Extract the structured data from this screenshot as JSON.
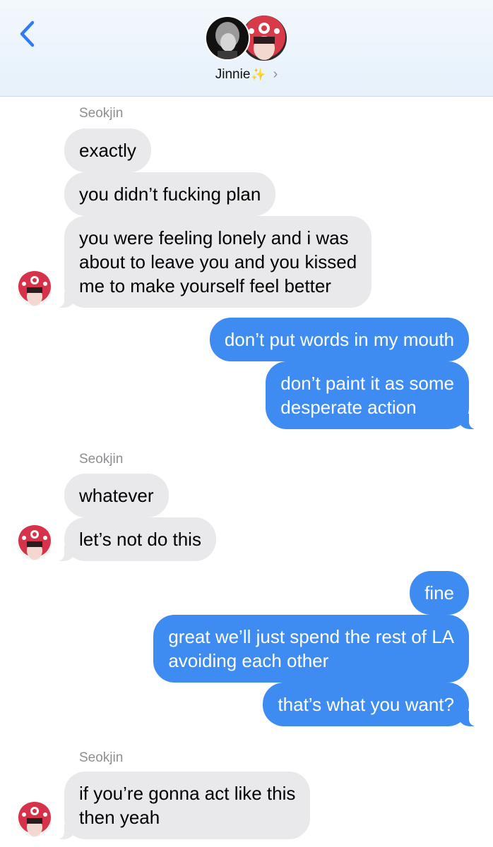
{
  "header": {
    "contact_name": "Jinnie",
    "sparkle": "✨",
    "chevron": "›",
    "back_icon": "chevron-left-icon"
  },
  "colors": {
    "incoming_bubble": "#e9e9eb",
    "outgoing_bubble": "#3e8cf2",
    "accent": "#2f7cf6",
    "header_bg": "#e8f2fc"
  },
  "messages": [
    {
      "sender_label": "Seokjin"
    },
    {
      "direction": "in",
      "text": "exactly"
    },
    {
      "direction": "in",
      "text": "you didn’t fucking plan"
    },
    {
      "direction": "in",
      "lines": [
        "you were feeling lonely and i was",
        "about to leave you and you kissed",
        "me to make yourself feel better"
      ]
    },
    {
      "direction": "out",
      "text": "don’t put words in my mouth"
    },
    {
      "direction": "out",
      "lines": [
        "don’t paint it as some",
        "desperate action"
      ]
    },
    {
      "sender_label": "Seokjin"
    },
    {
      "direction": "in",
      "text": "whatever"
    },
    {
      "direction": "in",
      "text": "let’s not do this"
    },
    {
      "direction": "out",
      "text": "fine"
    },
    {
      "direction": "out",
      "lines": [
        "great we’ll just spend the rest of LA",
        "avoiding each other"
      ]
    },
    {
      "direction": "out",
      "text": "that’s what you want?"
    },
    {
      "sender_label": "Seokjin"
    },
    {
      "direction": "in",
      "lines": [
        "if you’re gonna act like this",
        "then yeah"
      ]
    }
  ]
}
